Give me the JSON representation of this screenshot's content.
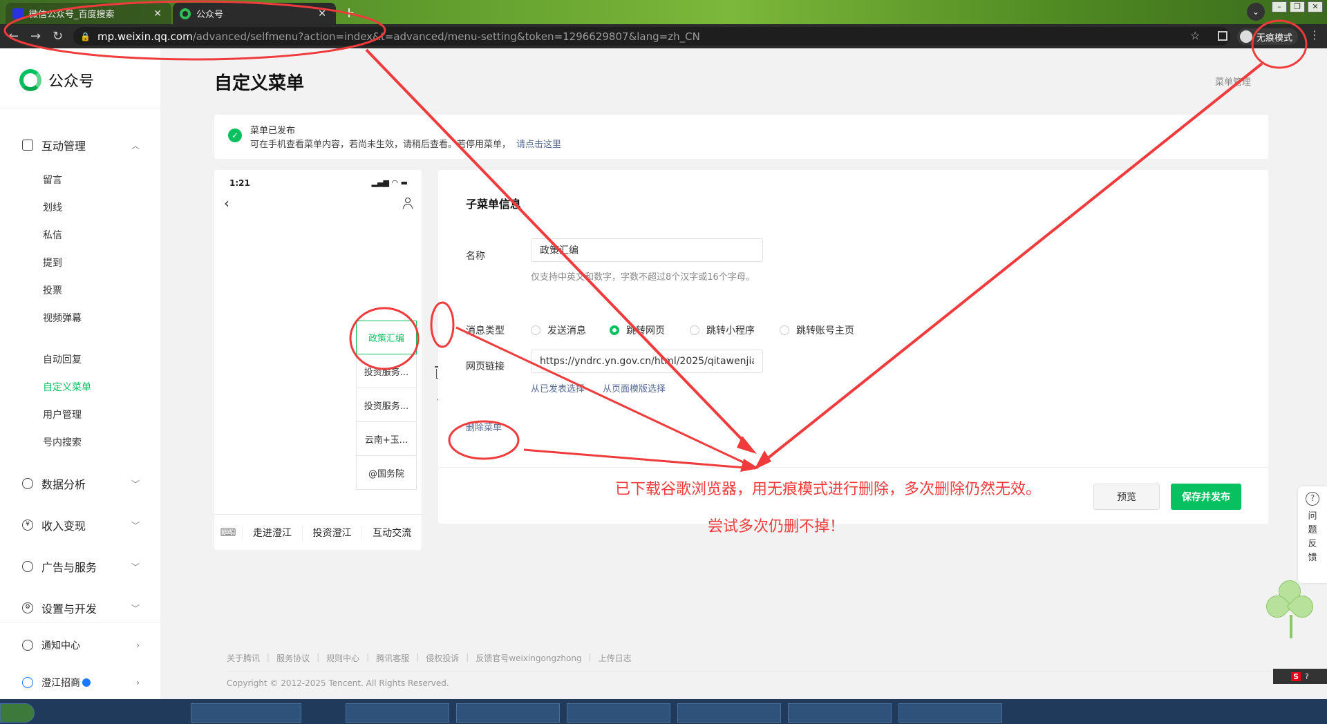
{
  "browser": {
    "tabs": [
      {
        "title": "微信公众号_百度搜索",
        "active": false
      },
      {
        "title": "公众号",
        "active": true
      }
    ],
    "url_host": "mp.weixin.qq.com",
    "url_path": "/advanced/selfmenu?action=index&t=advanced/menu-setting&token=1296629807&lang=zh_CN",
    "incognito_label": "无痕模式"
  },
  "sidebar": {
    "logo": "公众号",
    "groups": {
      "interaction": "互动管理",
      "data": "数据分析",
      "income": "收入变现",
      "ads": "广告与服务",
      "settings": "设置与开发",
      "notify": "通知中心",
      "account": "澄江招商"
    },
    "sub_items": [
      "留言",
      "划线",
      "私信",
      "提到",
      "投票",
      "视频弹幕",
      "自动回复",
      "自定义菜单",
      "用户管理",
      "号内搜索"
    ]
  },
  "main": {
    "title": "自定义菜单",
    "menu_mgmt": "菜单管理",
    "notice_title": "菜单已发布",
    "notice_desc": "可在手机查看菜单内容，若尚未生效，请稍后查看。若停用菜单，",
    "notice_link": "请点击这里"
  },
  "phone": {
    "time": "1:21",
    "submenu": [
      "政策汇编",
      "投资服务...",
      "投资服务...",
      "云南+玉...",
      "@国务院"
    ],
    "main_menu": [
      "走进澄江",
      "投资澄江",
      "互动交流"
    ]
  },
  "editor": {
    "title": "子菜单信息",
    "name_label": "名称",
    "name_value": "政策汇编",
    "name_hint": "仅支持中英文和数字，字数不超过8个汉字或16个字母。",
    "msg_type_label": "消息类型",
    "msg_types": [
      "发送消息",
      "跳转网页",
      "跳转小程序",
      "跳转账号主页"
    ],
    "selected_type": "跳转网页",
    "url_label": "网页链接",
    "url_value": "https://yndrc.yn.gov.cn/html/2025/qitawenjia",
    "link_published": "从已发表选择",
    "link_template": "从页面模版选择",
    "delete_menu": "删除菜单",
    "preview": "预览",
    "publish": "保存并发布"
  },
  "footer": {
    "links": [
      "关于腾讯",
      "服务协议",
      "规则中心",
      "腾讯客服",
      "侵权投诉",
      "反馈官号weixingongzhong",
      "上传日志"
    ],
    "copyright": "Copyright © 2012-2025 Tencent. All Rights Reserved."
  },
  "feedback": "问题反馈",
  "annotations": {
    "line1": "已下载谷歌浏览器，用无痕模式进行删除，多次删除仍然无效。",
    "line2": "尝试多次仍删不掉！"
  },
  "colors": {
    "brand_green": "#07c160",
    "annotation_red": "#ef3b3b",
    "link_blue": "#576b95"
  }
}
